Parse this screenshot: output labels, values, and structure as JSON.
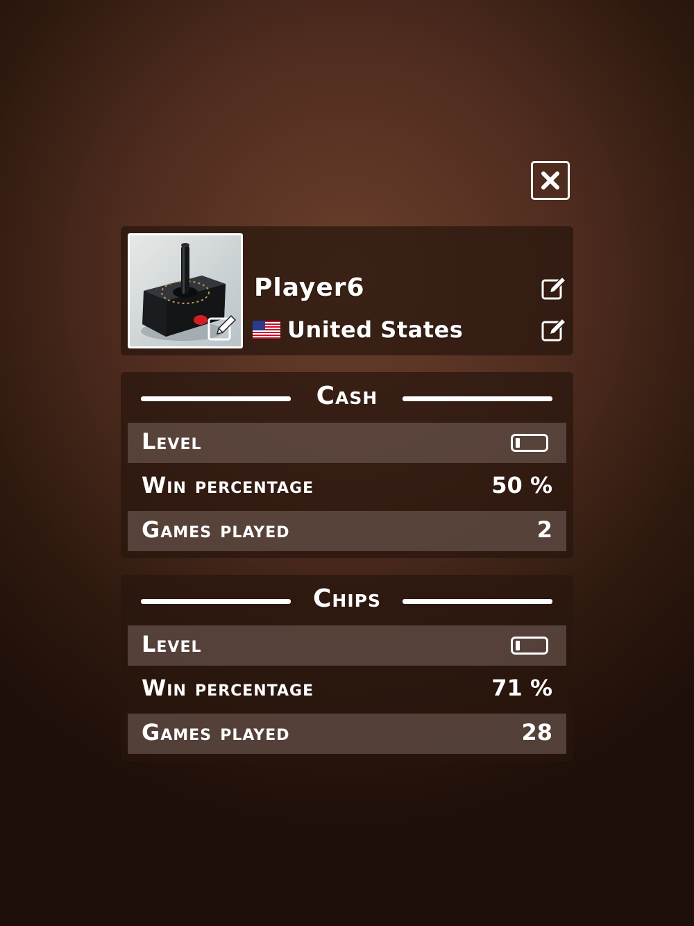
{
  "profile": {
    "name": "Player6",
    "country": "United States"
  },
  "icons": {
    "close": "close-icon",
    "edit": "edit-icon",
    "flag": "us-flag-icon",
    "level": "level-bar-icon"
  },
  "stats": [
    {
      "title": "Cash",
      "level_label": "Level",
      "level_progress": 0.1,
      "win_label": "Win percentage",
      "win_value": "50 %",
      "games_label": "Games played",
      "games_value": "2"
    },
    {
      "title": "Chips",
      "level_label": "Level",
      "level_progress": 0.1,
      "win_label": "Win percentage",
      "win_value": "71 %",
      "games_label": "Games played",
      "games_value": "28"
    }
  ]
}
